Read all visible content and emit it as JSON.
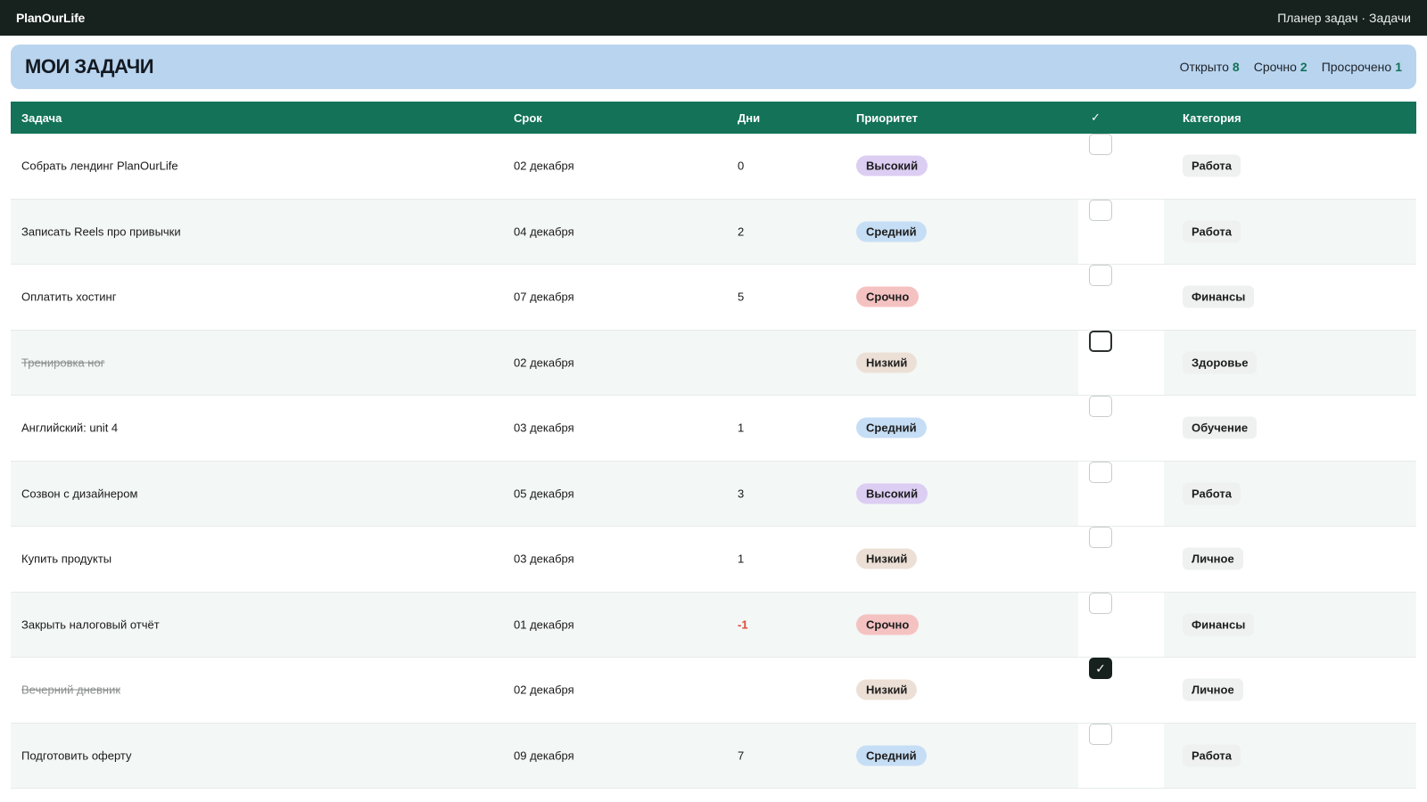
{
  "app": {
    "brand": "PlanOurLife",
    "breadcrumb": "Планер задач · Задачи"
  },
  "header": {
    "title": "МОИ ЗАДАЧИ",
    "stats": [
      {
        "label": "Открыто",
        "value": "8"
      },
      {
        "label": "Срочно",
        "value": "2"
      },
      {
        "label": "Просрочено",
        "value": "1"
      }
    ]
  },
  "table": {
    "columns": {
      "task": "Задача",
      "due": "Срок",
      "days": "Дни",
      "priority": "Приоритет",
      "done": "✓",
      "category": "Категория"
    },
    "rows": [
      {
        "task": "Собрать лендинг PlanOurLife",
        "due": "02 декабря",
        "days": "0",
        "priority": "Высокий",
        "done": false,
        "category": "Работа"
      },
      {
        "task": "Записать Reels про привычки",
        "due": "04 декабря",
        "days": "2",
        "priority": "Средний",
        "done": false,
        "category": "Работа"
      },
      {
        "task": "Оплатить хостинг",
        "due": "07 декабря",
        "days": "5",
        "priority": "Срочно",
        "done": false,
        "category": "Финансы"
      },
      {
        "task": "Тренировка ног",
        "due": "02 декабря",
        "days": "",
        "priority": "Низкий",
        "done": true,
        "category": "Здоровье"
      },
      {
        "task": "Английский: unit 4",
        "due": "03 декабря",
        "days": "1",
        "priority": "Средний",
        "done": false,
        "category": "Обучение"
      },
      {
        "task": "Созвон с дизайнером",
        "due": "05 декабря",
        "days": "3",
        "priority": "Высокий",
        "done": false,
        "category": "Работа"
      },
      {
        "task": "Купить продукты",
        "due": "03 декабря",
        "days": "1",
        "priority": "Низкий",
        "done": false,
        "category": "Личное"
      },
      {
        "task": "Закрыть налоговый отчёт",
        "due": "01 декабря",
        "days": "-1",
        "priority": "Срочно",
        "done": false,
        "category": "Финансы"
      },
      {
        "task": "Вечерний дневник",
        "due": "02 декабря",
        "days": "",
        "priority": "Низкий",
        "done": true,
        "category": "Личное"
      },
      {
        "task": "Подготовить оферту",
        "due": "09 декабря",
        "days": "7",
        "priority": "Средний",
        "done": false,
        "category": "Работа"
      }
    ]
  },
  "colors": {
    "topbar": "#17211e",
    "header_bg": "#b9d4ee",
    "table_head": "#137257",
    "stat_accent": "#137257",
    "overdue": "#e0463a",
    "priority": {
      "Высокий": "#dccdf3",
      "Средний": "#c6def5",
      "Срочно": "#f5c2c2",
      "Низкий": "#ece0d6"
    }
  }
}
